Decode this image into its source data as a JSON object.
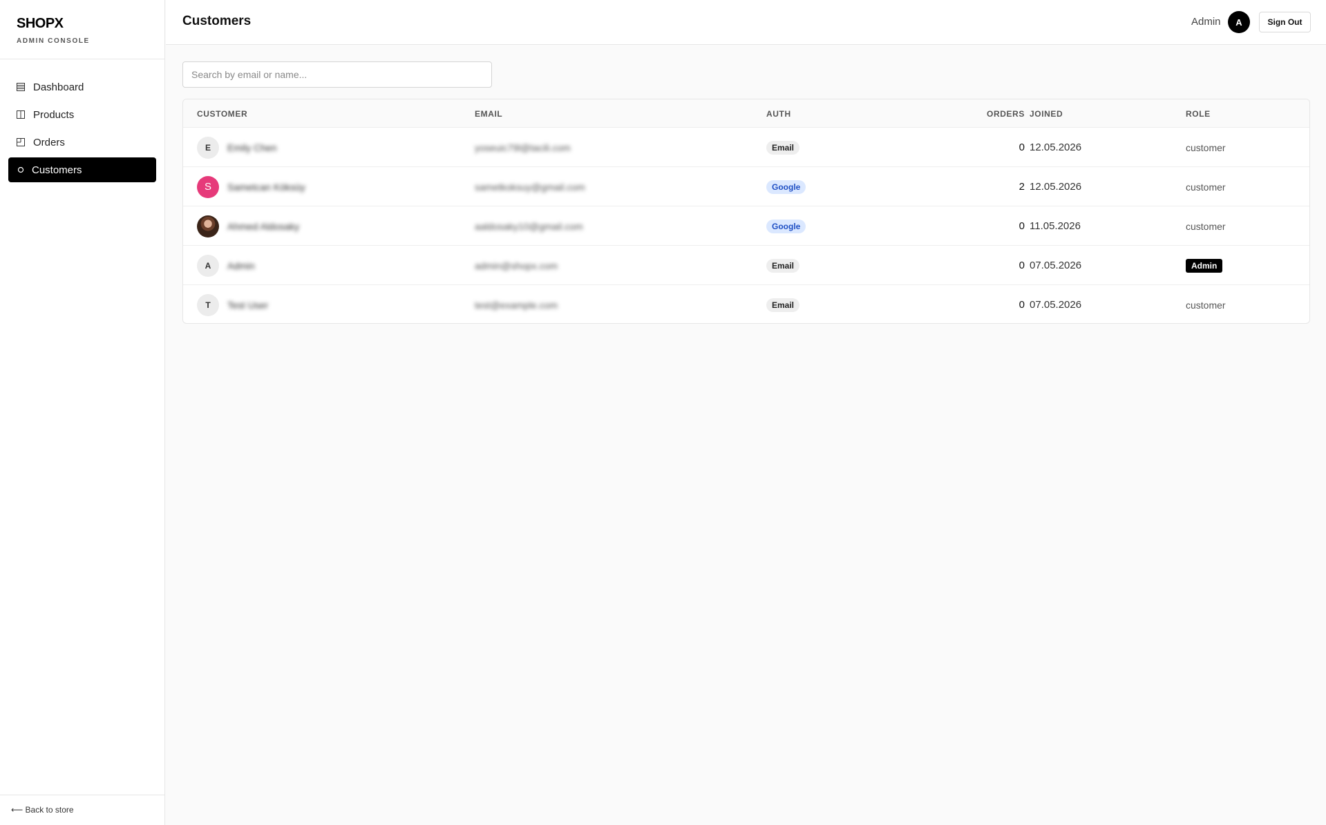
{
  "brand": {
    "name": "SHOPX",
    "subtitle": "ADMIN CONSOLE"
  },
  "sidebar": {
    "items": [
      {
        "label": "Dashboard",
        "icon": "grid-icon"
      },
      {
        "label": "Products",
        "icon": "columns-icon"
      },
      {
        "label": "Orders",
        "icon": "receipt-icon"
      },
      {
        "label": "Customers",
        "icon": "circle-icon",
        "active": true
      }
    ],
    "back_label": "⟵ Back to store"
  },
  "header": {
    "title": "Customers",
    "user_label": "Admin",
    "avatar_initial": "A",
    "signout_label": "Sign Out"
  },
  "search": {
    "placeholder": "Search by email or name...",
    "value": ""
  },
  "table": {
    "columns": [
      "CUSTOMER",
      "EMAIL",
      "AUTH",
      "ORDERS",
      "JOINED",
      "ROLE"
    ],
    "rows": [
      {
        "initial": "E",
        "name": "Emily Chen",
        "email": "yoseuic79l@tacili.com",
        "auth": "Email",
        "orders": "0",
        "joined": "12.05.2026",
        "role": "customer"
      },
      {
        "initial": "S",
        "name": "Sametcan Köksüy",
        "email": "sametkoksuy@gmail.com",
        "auth": "Google",
        "orders": "2",
        "joined": "12.05.2026",
        "role": "customer"
      },
      {
        "initial": "",
        "name": "Ahmed Aldosaky",
        "email": "aaldosaky10@gmail.com",
        "auth": "Google",
        "orders": "0",
        "joined": "11.05.2026",
        "role": "customer"
      },
      {
        "initial": "A",
        "name": "Admin",
        "email": "admin@shopx.com",
        "auth": "Email",
        "orders": "0",
        "joined": "07.05.2026",
        "role": "Admin"
      },
      {
        "initial": "T",
        "name": "Test User",
        "email": "test@example.com",
        "auth": "Email",
        "orders": "0",
        "joined": "07.05.2026",
        "role": "customer"
      }
    ]
  },
  "colors": {
    "accent": "#000000",
    "google_badge_bg": "#dbe8ff",
    "google_badge_text": "#1f4fc4",
    "avatar_pink": "#e63a7a"
  }
}
